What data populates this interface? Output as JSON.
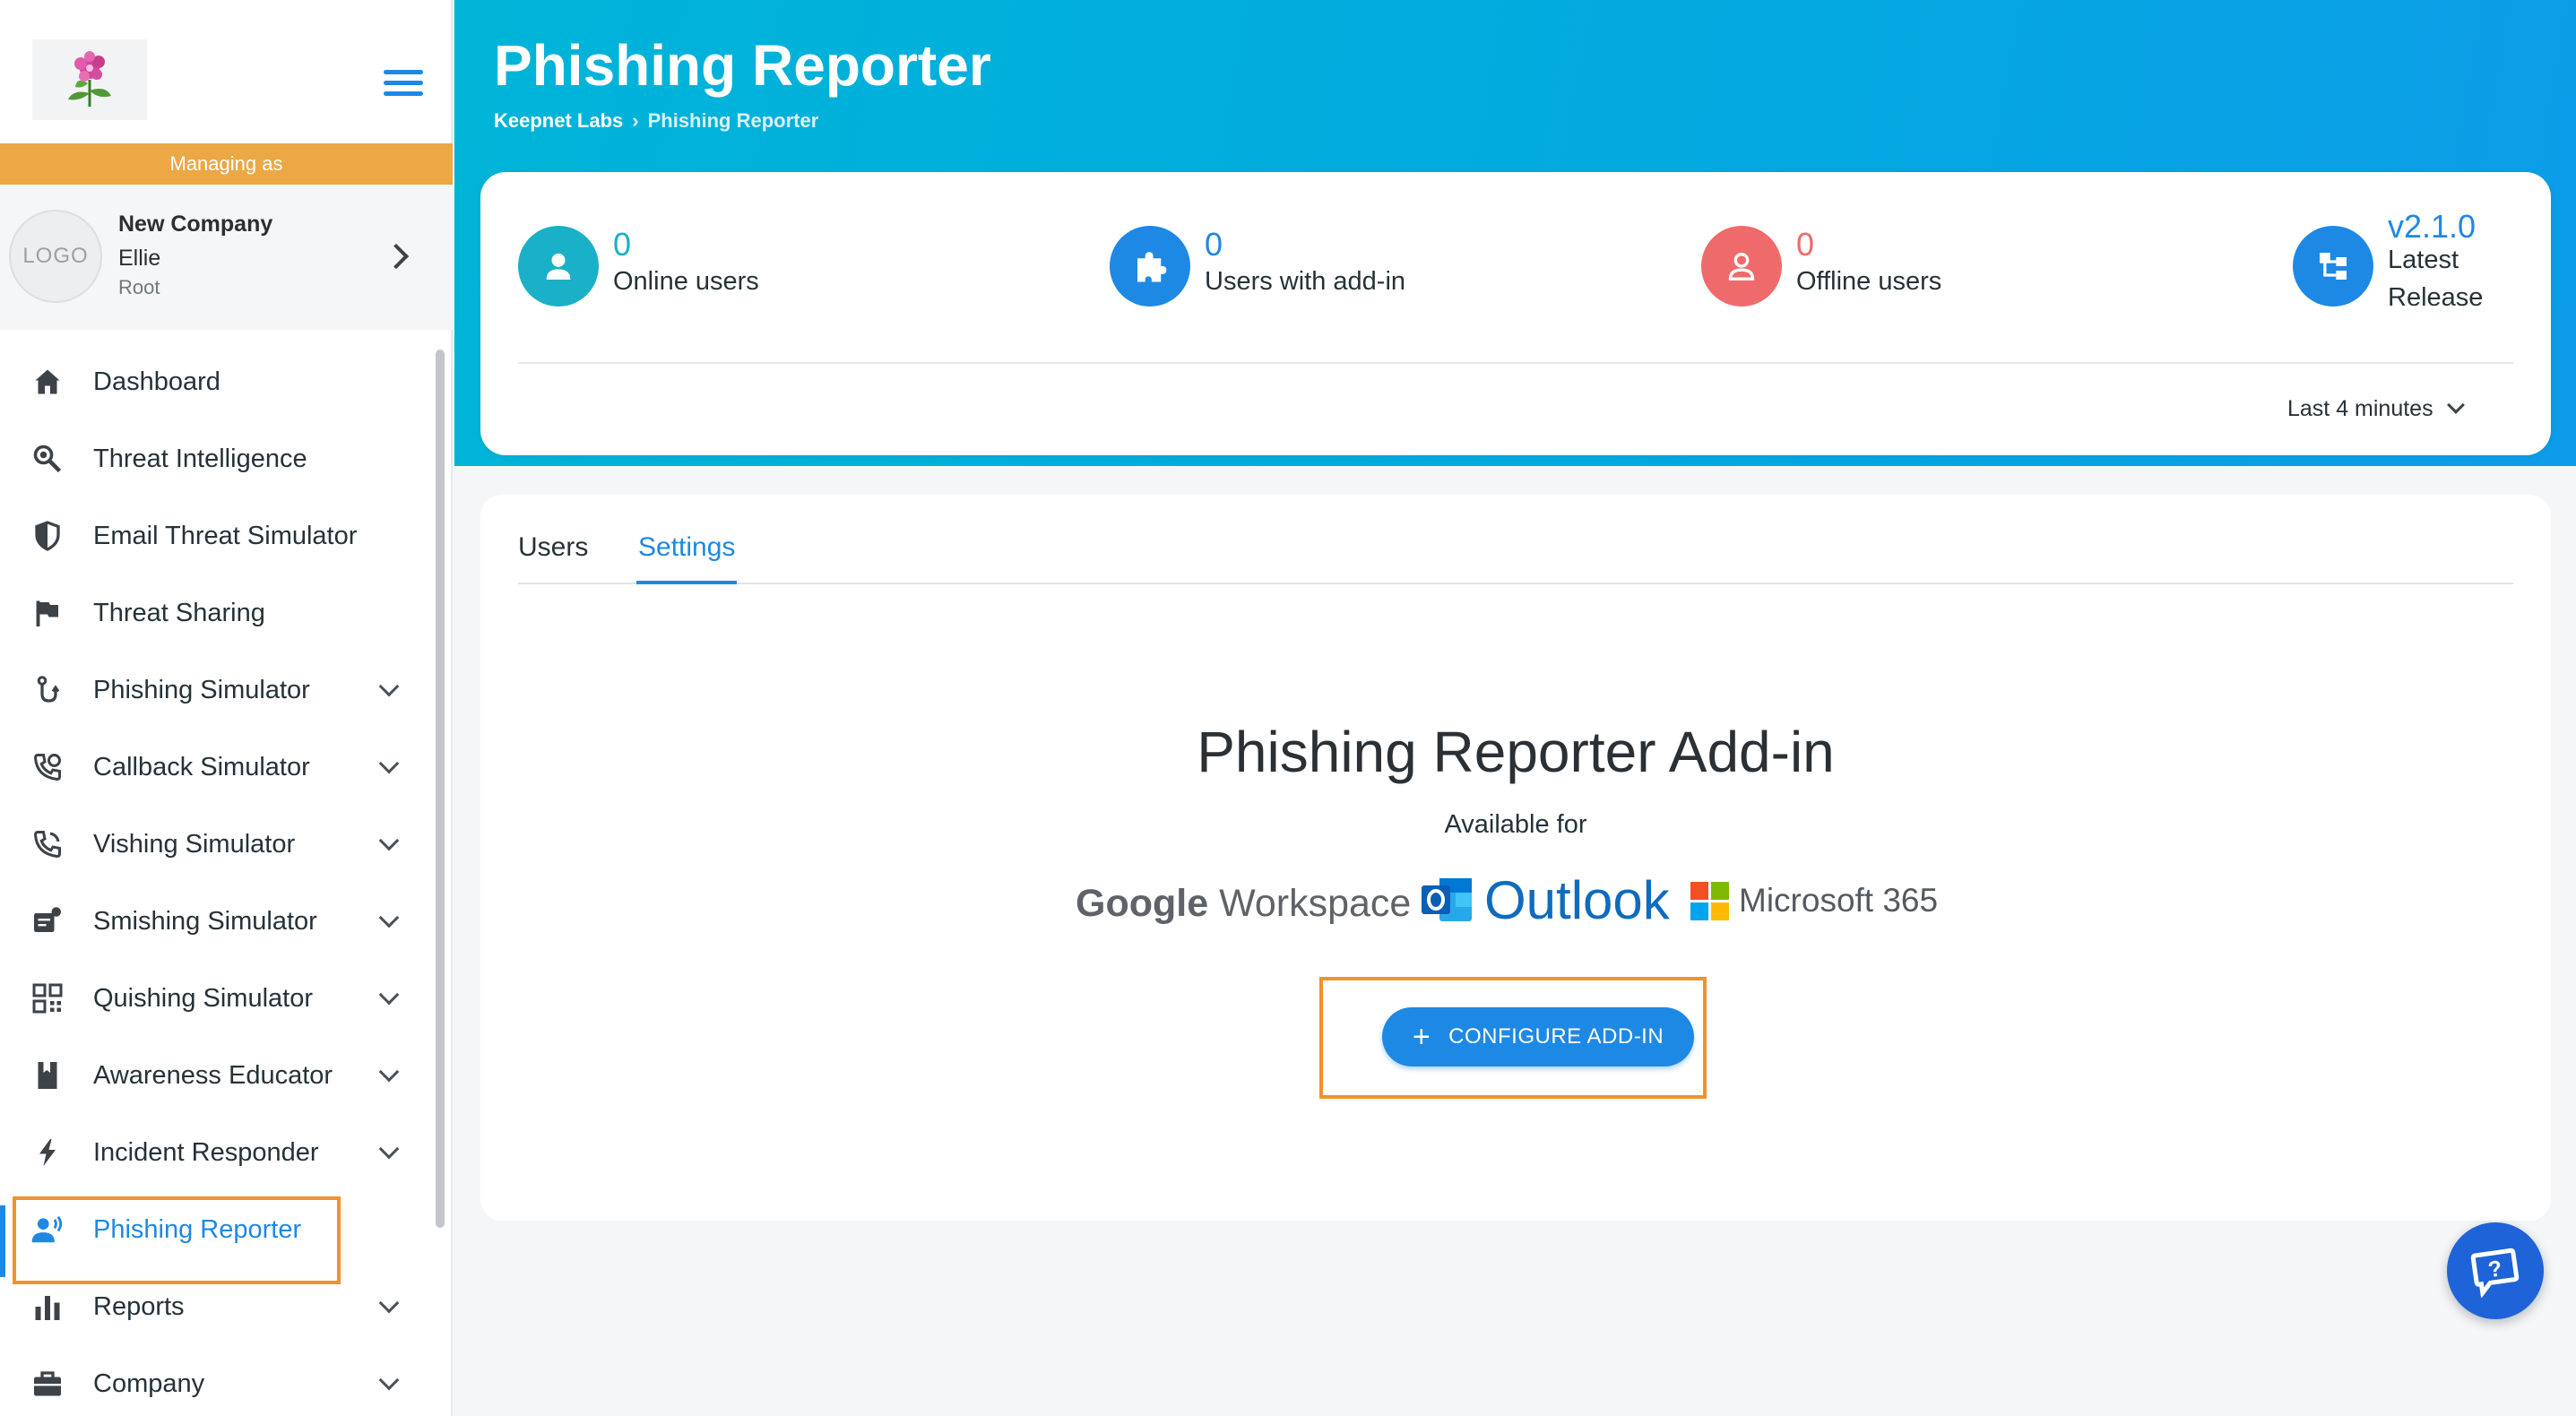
{
  "sidebar": {
    "brand_logo_icon": "flower-logo",
    "menu_icon": "hamburger-menu-icon",
    "managing_as": "Managing as",
    "account": {
      "logo_text": "LOGO",
      "company": "New Company",
      "user": "Ellie",
      "role": "Root"
    },
    "items": [
      {
        "label": "Dashboard",
        "icon": "home-icon",
        "expandable": false
      },
      {
        "label": "Threat Intelligence",
        "icon": "search-bug-icon",
        "expandable": false
      },
      {
        "label": "Email Threat Simulator",
        "icon": "shield-icon",
        "expandable": false
      },
      {
        "label": "Threat Sharing",
        "icon": "flag-icon",
        "expandable": false
      },
      {
        "label": "Phishing Simulator",
        "icon": "hook-icon",
        "expandable": true
      },
      {
        "label": "Callback Simulator",
        "icon": "phone-callback-icon",
        "expandable": true
      },
      {
        "label": "Vishing Simulator",
        "icon": "phone-icon",
        "expandable": true
      },
      {
        "label": "Smishing Simulator",
        "icon": "sms-icon",
        "expandable": true
      },
      {
        "label": "Quishing Simulator",
        "icon": "qr-code-icon",
        "expandable": true
      },
      {
        "label": "Awareness Educator",
        "icon": "book-icon",
        "expandable": true
      },
      {
        "label": "Incident Responder",
        "icon": "bolt-icon",
        "expandable": true
      },
      {
        "label": "Phishing Reporter",
        "icon": "user-voice-icon",
        "expandable": false,
        "active": true
      },
      {
        "label": "Reports",
        "icon": "bar-chart-icon",
        "expandable": true
      },
      {
        "label": "Company",
        "icon": "briefcase-icon",
        "expandable": true
      }
    ]
  },
  "header": {
    "title": "Phishing Reporter",
    "breadcrumb": [
      "Keepnet Labs",
      "Phishing Reporter"
    ]
  },
  "stats": {
    "online": {
      "value": "0",
      "label": "Online users",
      "color": "#1ab0c8"
    },
    "addin": {
      "value": "0",
      "label": "Users with add-in",
      "color": "#1e88e5"
    },
    "offline": {
      "value": "0",
      "label": "Offline users",
      "color": "#ef6b6b"
    },
    "release": {
      "value": "v2.1.0",
      "label_line1": "Latest",
      "label_line2": "Release",
      "color": "#1e88e5"
    },
    "time_range": "Last 4 minutes"
  },
  "tabs": [
    {
      "label": "Users",
      "active": false
    },
    {
      "label": "Settings",
      "active": true
    }
  ],
  "addin": {
    "title": "Phishing Reporter Add-in",
    "available_for": "Available for",
    "platforms": {
      "google": "Google Workspace",
      "google_brand": "Google",
      "google_product": "Workspace",
      "outlook": "Outlook",
      "microsoft": "Microsoft 365"
    },
    "configure_button": "CONFIGURE ADD-IN",
    "configure_icon": "plus-icon"
  },
  "help_icon": "help-chat-icon",
  "colors": {
    "accent": "#1e88e5",
    "header_gradient_start": "#00b4d8",
    "managing_bar": "#eba845",
    "highlight_box": "#f0932b",
    "offline": "#ef6b6b"
  }
}
